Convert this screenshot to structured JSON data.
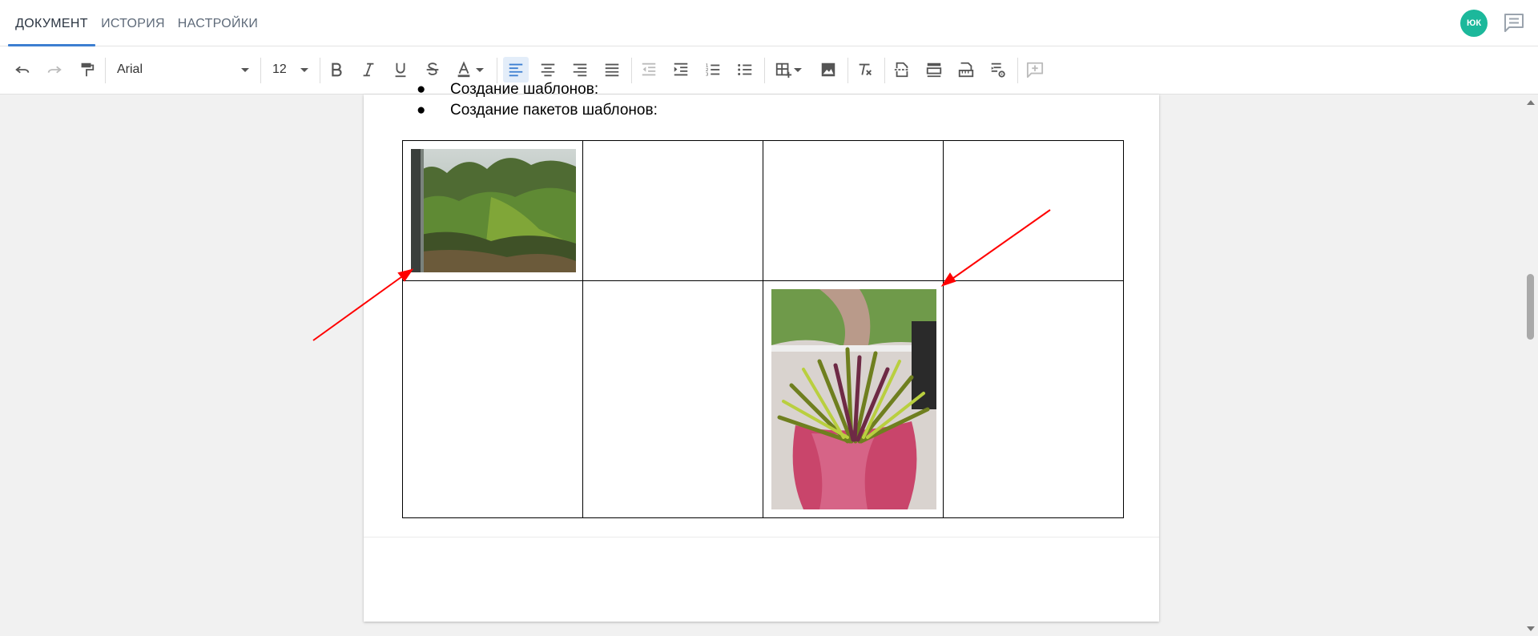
{
  "tabs": [
    {
      "label": "ДОКУМЕНТ",
      "active": true
    },
    {
      "label": "ИСТОРИЯ",
      "active": false
    },
    {
      "label": "НАСТРОЙКИ",
      "active": false
    }
  ],
  "user": {
    "initials": "ЮК",
    "avatar_color": "#1cb89b"
  },
  "toolbar": {
    "font_family": "Arial",
    "font_size": "12",
    "alignment": "left"
  },
  "document": {
    "bullets": [
      "Создание шаблонов:",
      "Создание пакетов шаблонов:"
    ],
    "table": {
      "rows": 2,
      "cols": 4,
      "images": [
        {
          "row": 0,
          "col": 0,
          "subject": "forest-through-window-photo"
        },
        {
          "row": 1,
          "col": 2,
          "subject": "potted-heather-plant-photo"
        }
      ]
    }
  },
  "annotations": {
    "arrow_color": "#ff0000",
    "arrows": 2
  },
  "colors": {
    "accent": "#3d7fd1",
    "selected_bg": "#e3edf9"
  }
}
